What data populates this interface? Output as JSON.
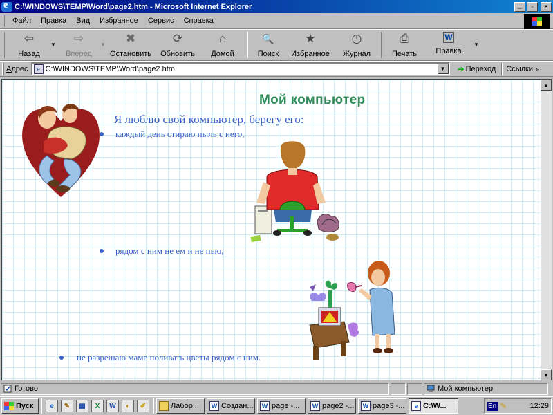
{
  "window": {
    "title": "C:\\WINDOWS\\TEMP\\Word\\page2.htm - Microsoft Internet Explorer",
    "minimize_glyph": "_",
    "maximize_glyph": "▫",
    "close_glyph": "×"
  },
  "menu": [
    "Файл",
    "Правка",
    "Вид",
    "Избранное",
    "Сервис",
    "Справка"
  ],
  "toolbar": {
    "back": {
      "label": "Назад",
      "icon": "back-arrow-icon",
      "glyph": "⇦"
    },
    "forward": {
      "label": "Вперед",
      "icon": "forward-arrow-icon",
      "glyph": "⇨"
    },
    "stop": {
      "label": "Остановить",
      "icon": "stop-icon",
      "glyph": "✖"
    },
    "refresh": {
      "label": "Обновить",
      "icon": "refresh-icon",
      "glyph": "⟳"
    },
    "home": {
      "label": "Домой",
      "icon": "home-icon",
      "glyph": "⌂"
    },
    "search": {
      "label": "Поиск",
      "icon": "search-icon",
      "glyph": "🔍"
    },
    "favorites": {
      "label": "Избранное",
      "icon": "favorites-icon",
      "glyph": "★"
    },
    "history": {
      "label": "Журнал",
      "icon": "history-icon",
      "glyph": "◷"
    },
    "print": {
      "label": "Печать",
      "icon": "printer-icon",
      "glyph": "⎙"
    },
    "edit": {
      "label": "Правка",
      "icon": "word-edit-icon",
      "glyph": "W"
    }
  },
  "address": {
    "label": "Адрес",
    "value": "C:\\WINDOWS\\TEMP\\Word\\page2.htm",
    "go_label": "Переход",
    "links_label": "Ссылки",
    "more_glyph": "»"
  },
  "page": {
    "title": "Мой компьютер",
    "intro": "Я люблю свой компьютер, берегу его:",
    "bullets": [
      "каждый день стираю пыль с него,",
      "рядом с ним не ем и не пью,",
      "не разрешаю маме поливать цветы рядом с ним."
    ],
    "colors": {
      "title": "#2e8b57",
      "text": "#3a60c8",
      "grid": "#cdeff6"
    }
  },
  "status": {
    "text": "Готово",
    "zone": "Мой компьютер"
  },
  "taskbar": {
    "start_label": "Пуск",
    "quicklaunch": [
      "e",
      "✎",
      "▦",
      "X",
      "W",
      "◐",
      "✐"
    ],
    "tasks": [
      {
        "label": "Лабор...",
        "icon": "folder-icon"
      },
      {
        "label": "Создан...",
        "icon": "word-icon"
      },
      {
        "label": "page -...",
        "icon": "word-icon"
      },
      {
        "label": "page2 -...",
        "icon": "word-icon"
      },
      {
        "label": "page3 -...",
        "icon": "word-icon"
      },
      {
        "label": "C:\\W...",
        "icon": "ie-icon"
      }
    ],
    "lang": "En",
    "clock": "12:29"
  }
}
